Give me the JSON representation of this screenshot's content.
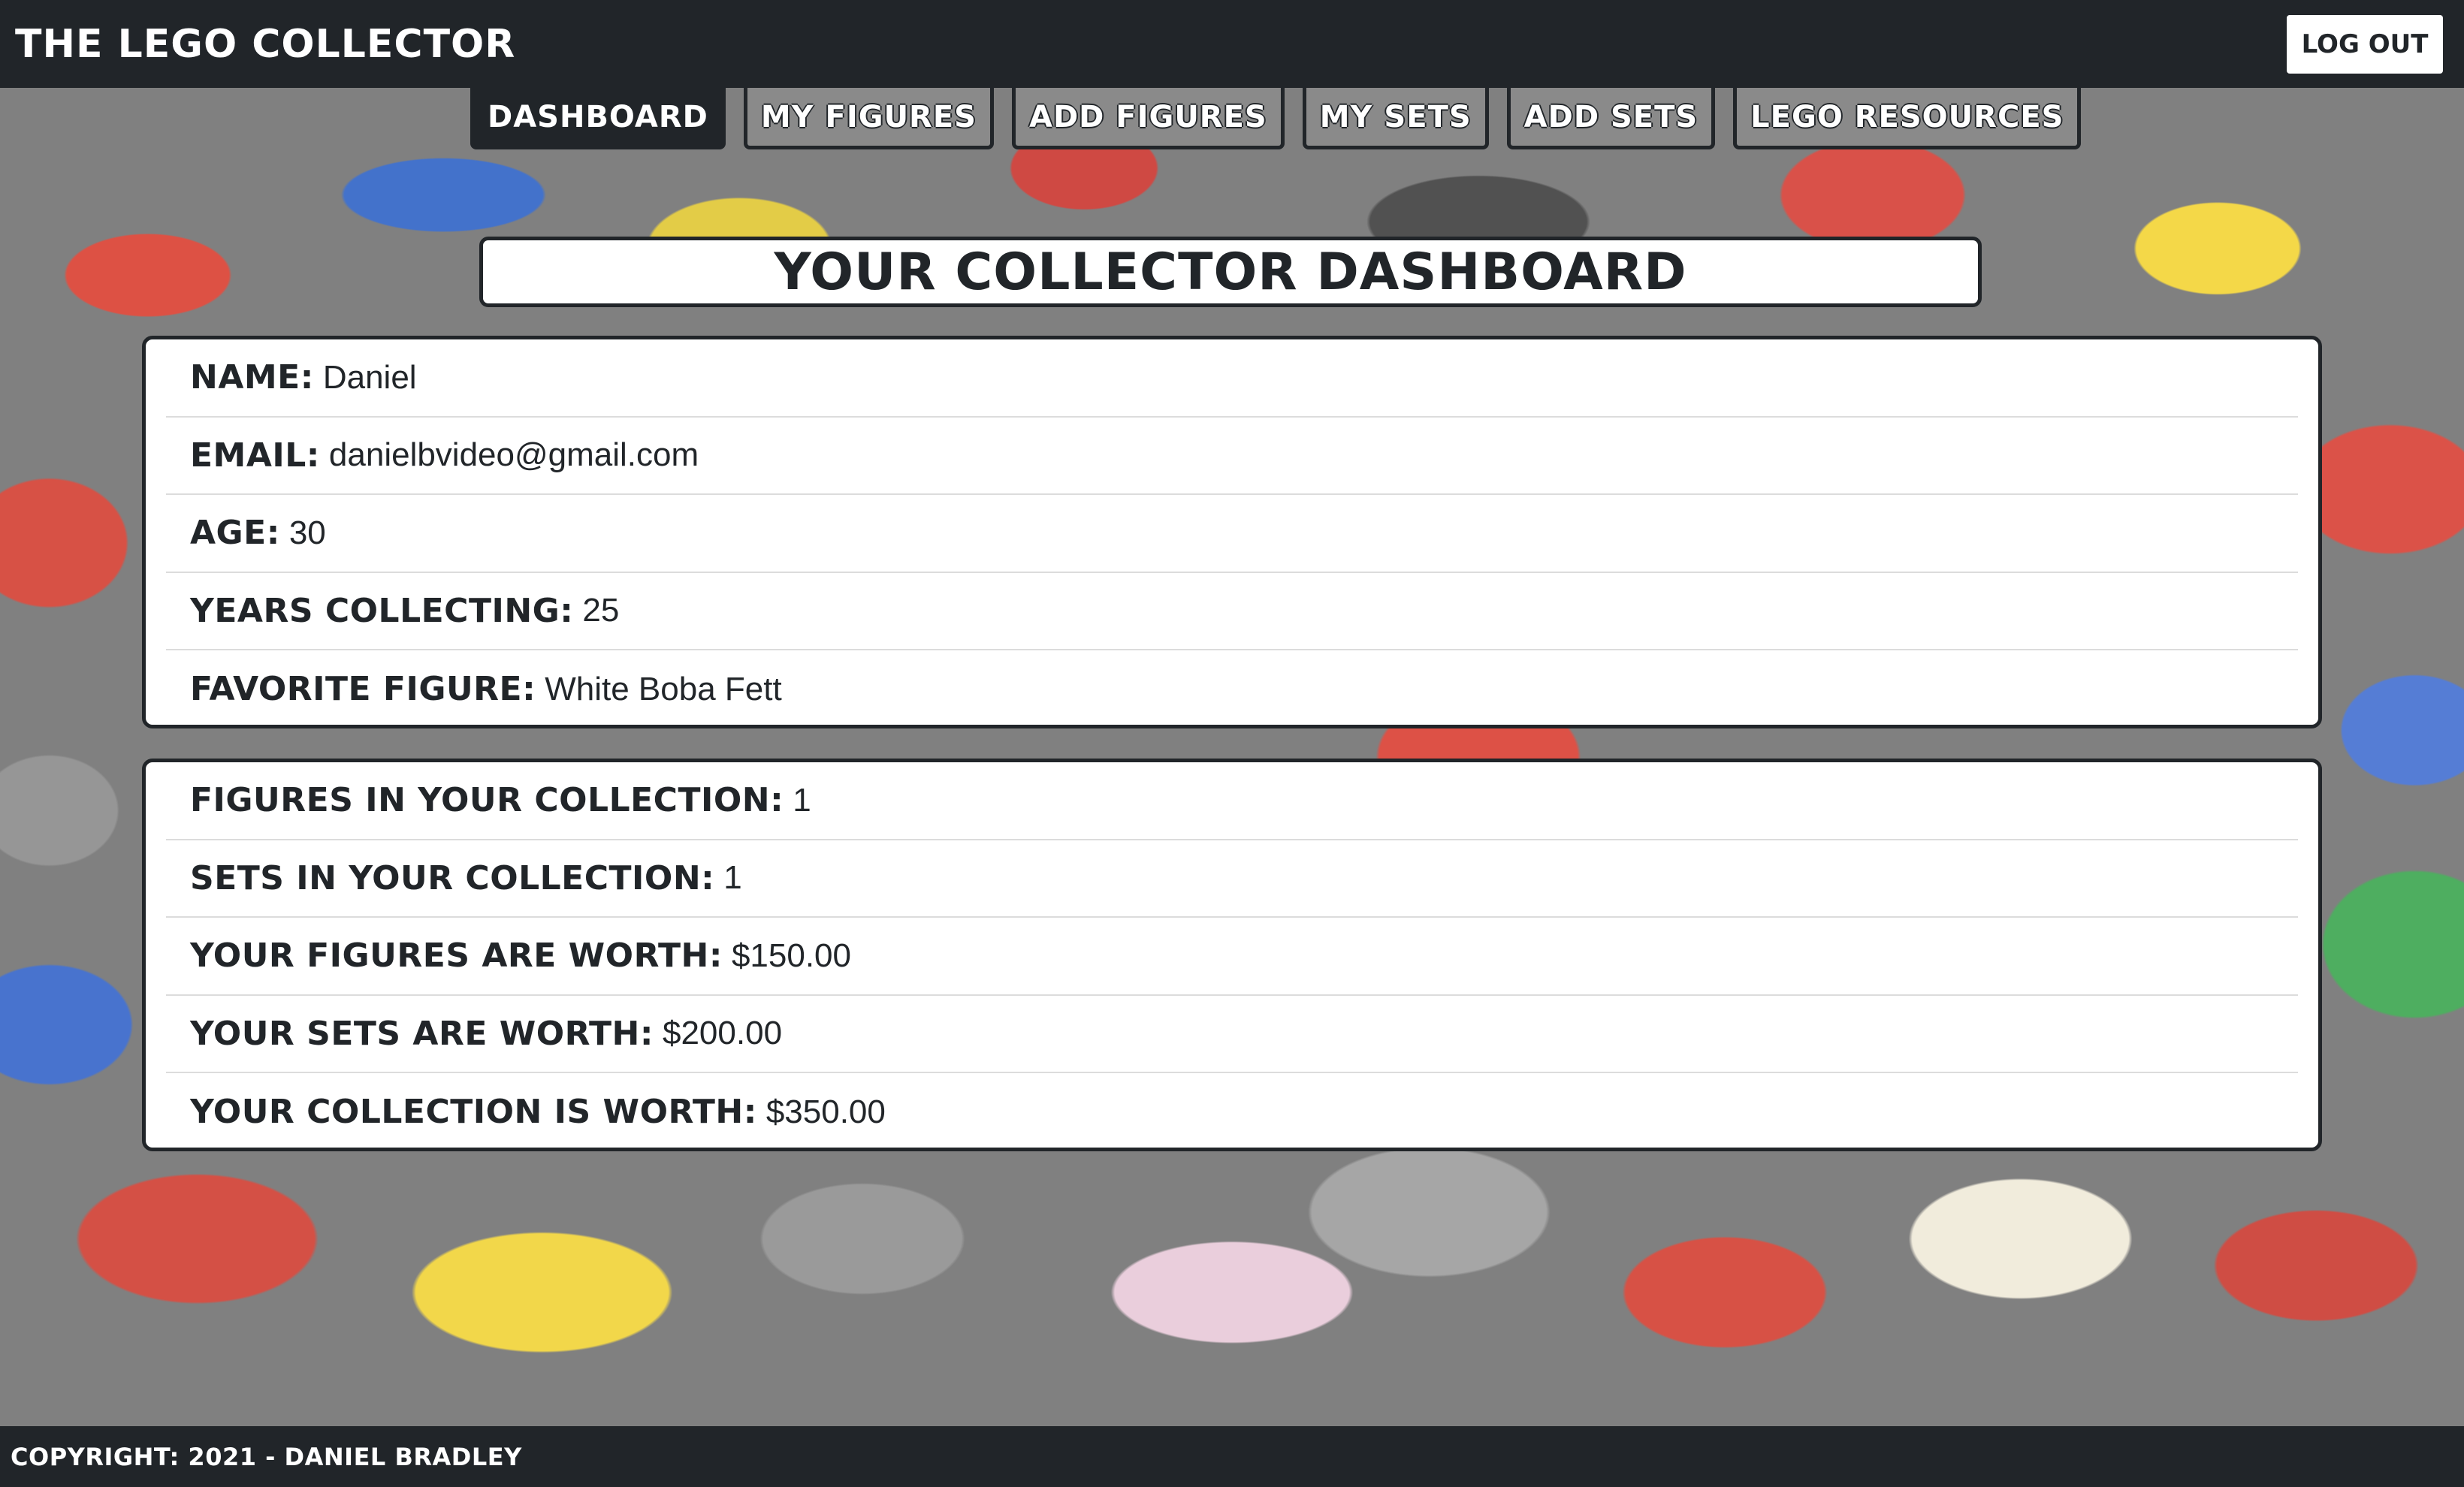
{
  "header": {
    "brand": "THE LEGO COLLECTOR",
    "logout_label": "LOG OUT"
  },
  "nav": {
    "tabs": [
      {
        "label": "DASHBOARD",
        "active": true
      },
      {
        "label": "MY FIGURES",
        "active": false
      },
      {
        "label": "ADD FIGURES",
        "active": false
      },
      {
        "label": "MY SETS",
        "active": false
      },
      {
        "label": "ADD SETS",
        "active": false
      },
      {
        "label": "LEGO RESOURCES",
        "active": false
      }
    ]
  },
  "page_title": "YOUR COLLECTOR DASHBOARD",
  "profile": [
    {
      "label": "NAME:",
      "value": "Daniel"
    },
    {
      "label": "EMAIL:",
      "value": "danielbvideo@gmail.com"
    },
    {
      "label": "AGE:",
      "value": "30"
    },
    {
      "label": "YEARS COLLECTING:",
      "value": "25"
    },
    {
      "label": "FAVORITE FIGURE:",
      "value": "White Boba Fett"
    }
  ],
  "stats": [
    {
      "label": "FIGURES IN YOUR COLLECTION:",
      "value": "1"
    },
    {
      "label": "SETS IN YOUR COLLECTION:",
      "value": "1"
    },
    {
      "label": "YOUR FIGURES ARE WORTH:",
      "value": "$150.00"
    },
    {
      "label": "YOUR SETS ARE WORTH:",
      "value": "$200.00"
    },
    {
      "label": "YOUR COLLECTION IS WORTH:",
      "value": "$350.00"
    }
  ],
  "footer": {
    "text": "COPYRIGHT: 2021 - DANIEL BRADLEY"
  },
  "colors": {
    "dark": "#212529",
    "tab_inactive": "#8a8a8a",
    "card_bg": "#ffffff"
  }
}
